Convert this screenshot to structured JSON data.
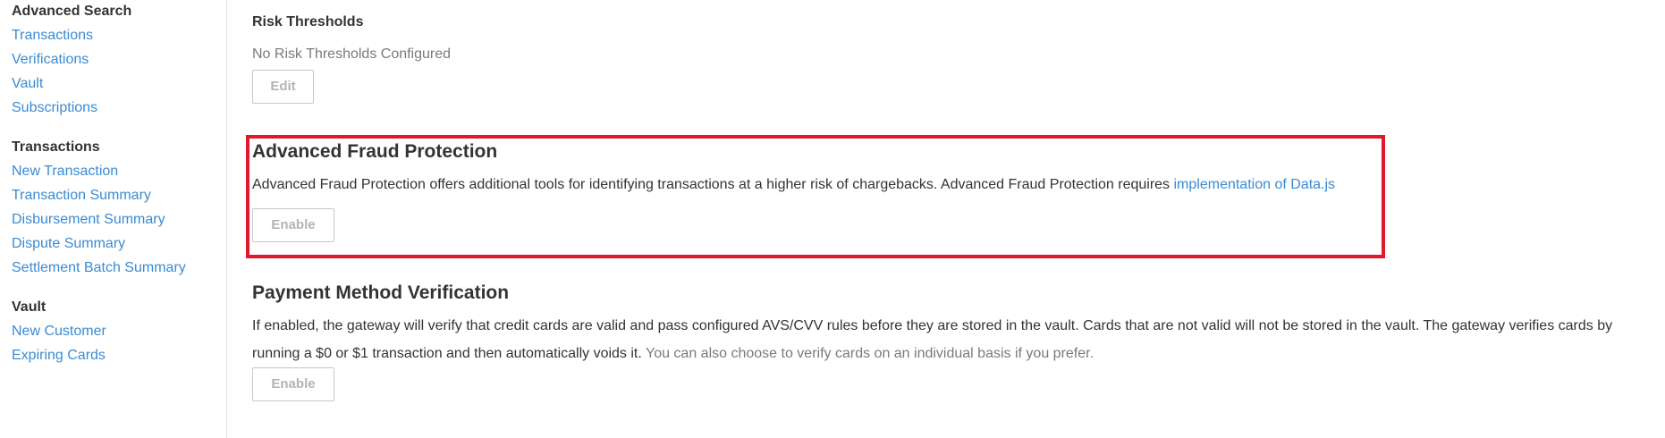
{
  "sidebar": {
    "advanced_search": {
      "heading": "Advanced Search",
      "links": [
        "Transactions",
        "Verifications",
        "Vault",
        "Subscriptions"
      ]
    },
    "transactions": {
      "heading": "Transactions",
      "links": [
        "New Transaction",
        "Transaction Summary",
        "Disbursement Summary",
        "Dispute Summary",
        "Settlement Batch Summary"
      ]
    },
    "vault": {
      "heading": "Vault",
      "links": [
        "New Customer",
        "Expiring Cards"
      ]
    }
  },
  "risk_thresholds": {
    "title": "Risk Thresholds",
    "status": "No Risk Thresholds Configured",
    "edit_label": "Edit"
  },
  "fraud_protection": {
    "title": "Advanced Fraud Protection",
    "description": "Advanced Fraud Protection offers additional tools for identifying transactions at a higher risk of chargebacks. Advanced Fraud Protection requires ",
    "link_text": "implementation of Data.js",
    "enable_label": "Enable"
  },
  "payment_verification": {
    "title": "Payment Method Verification",
    "description_line1": "If enabled, the gateway will verify that credit cards are valid and pass configured AVS/CVV rules before they are stored in the vault. Cards that are not valid will not be stored in the vault. The gateway verifies cards by",
    "description_line2": "running a $0 or $1 transaction and then automatically voids it.",
    "description_muted": " You can also choose to verify cards on an individual basis if you prefer.",
    "enable_label": "Enable"
  },
  "colors": {
    "link": "#3a8bd2",
    "highlight": "#e0192c",
    "muted_text": "#7a7a7a"
  }
}
